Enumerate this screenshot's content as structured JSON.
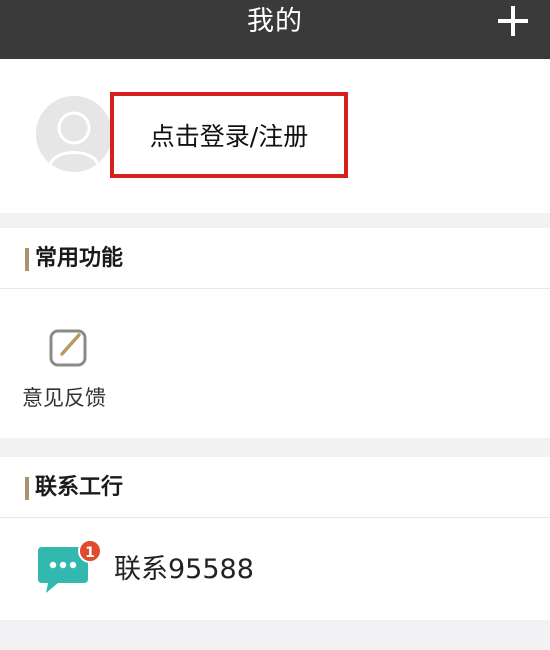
{
  "header": {
    "title": "我的",
    "add_icon": "plus-icon"
  },
  "profile": {
    "login_text": "点击登录/注册",
    "avatar_icon": "user-avatar-icon"
  },
  "common_functions": {
    "title": "常用功能",
    "items": [
      {
        "label": "意见反馈",
        "icon": "edit-feedback-icon"
      }
    ]
  },
  "contact": {
    "title": "联系工行",
    "label": "联系95588",
    "icon": "chat-bubble-icon",
    "badge": "1"
  },
  "colors": {
    "topbar": "#3a3a3a",
    "accent_bar": "#a8936a",
    "highlight_border": "#d62020",
    "chat_icon": "#33b8b0",
    "badge": "#e04a2e"
  }
}
